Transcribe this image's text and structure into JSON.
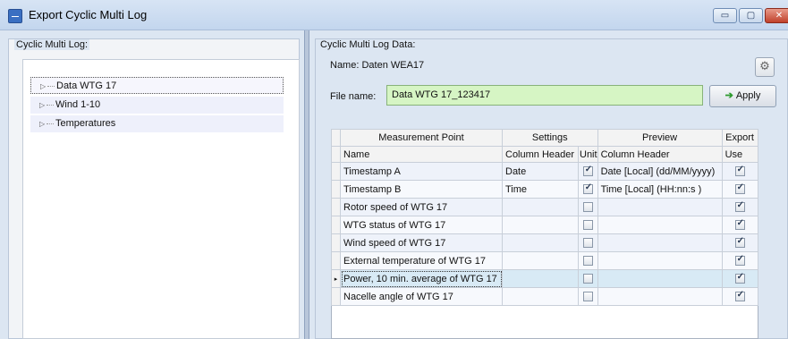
{
  "window": {
    "title": "Export Cyclic Multi Log",
    "minimize": "▭",
    "maximize": "▢",
    "close": "✕"
  },
  "left": {
    "group_label": "Cyclic Multi Log:",
    "tree": [
      "Data WTG 17",
      "Wind 1-10",
      "Temperatures"
    ]
  },
  "right": {
    "group_label": "Cyclic Multi Log Data:",
    "name_label": "Name:",
    "name_value": "Daten WEA17",
    "file_name_label": "File name:",
    "file_name_value": "Data WTG 17_123417",
    "apply_label": "Apply"
  },
  "grid": {
    "group_headers": [
      "Measurement Point",
      "Settings",
      "Preview",
      "Export"
    ],
    "sub_headers": [
      "Name",
      "Column Header",
      "Unit",
      "Column Header",
      "Use"
    ],
    "rows": [
      {
        "name": "Timestamp A",
        "column_header": "Date",
        "unit": true,
        "preview": "Date [Local] (dd/MM/yyyy)",
        "use": true
      },
      {
        "name": "Timestamp B",
        "column_header": "Time",
        "unit": true,
        "preview": "Time [Local] (HH:nn:s )",
        "use": true
      },
      {
        "name": "Rotor speed of WTG 17",
        "column_header": "",
        "unit": false,
        "preview": "",
        "use": true
      },
      {
        "name": "WTG status of WTG 17",
        "column_header": "",
        "unit": false,
        "preview": "",
        "use": true
      },
      {
        "name": "Wind speed of WTG 17",
        "column_header": "",
        "unit": false,
        "preview": "",
        "use": true
      },
      {
        "name": "External temperature of WTG 17",
        "column_header": "",
        "unit": false,
        "preview": "",
        "use": true
      },
      {
        "name": "Power, 10 min. average of WTG 17",
        "column_header": "",
        "unit": false,
        "preview": "",
        "use": true
      },
      {
        "name": "Nacelle angle of WTG 17",
        "column_header": "",
        "unit": false,
        "preview": "",
        "use": true
      }
    ],
    "selected_row": 6
  }
}
